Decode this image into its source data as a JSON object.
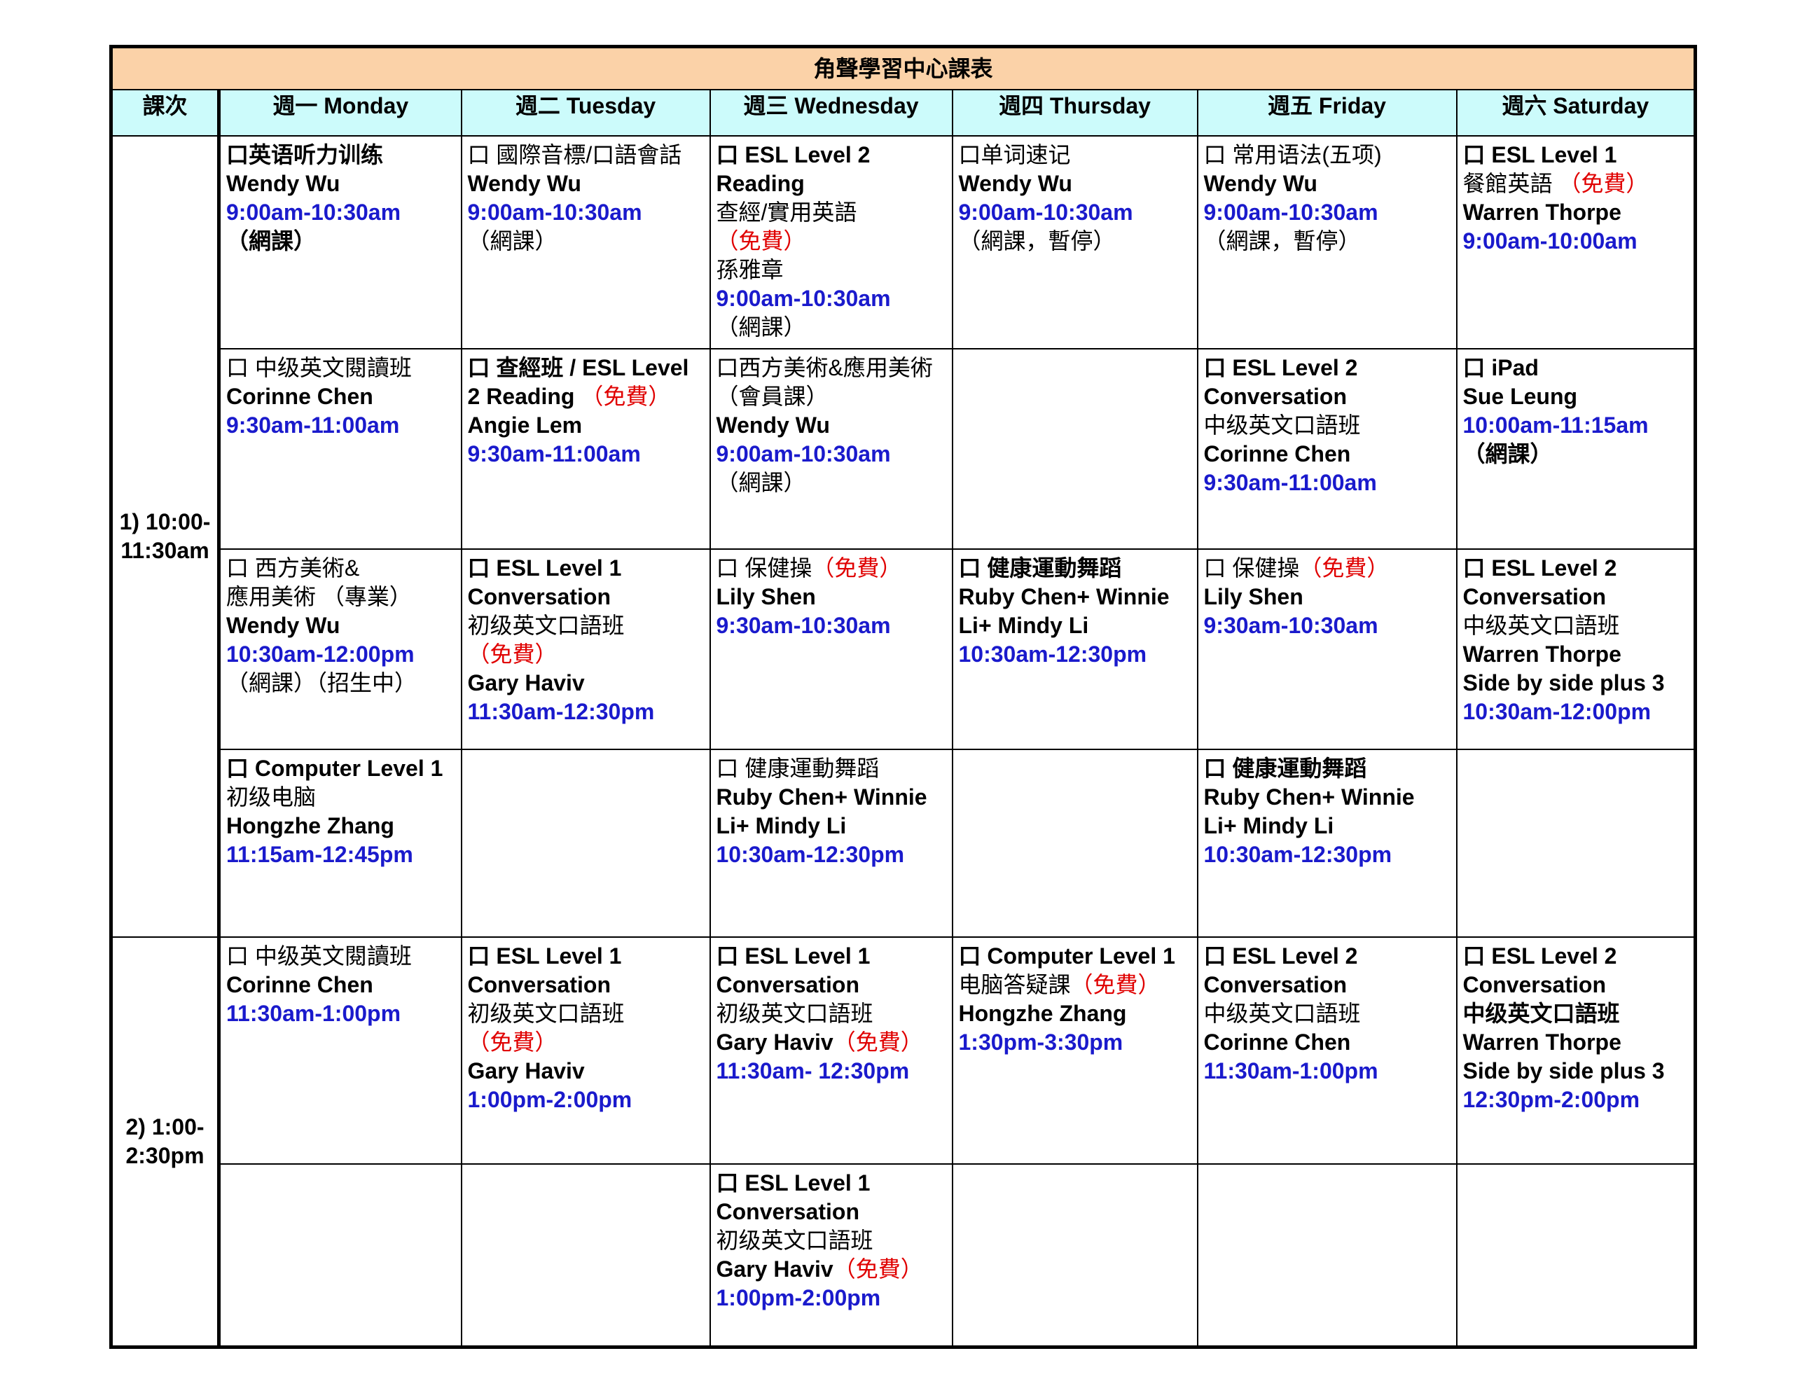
{
  "title": "角聲學習中心課表",
  "headers": {
    "period": "課次",
    "mon": "週一 Monday",
    "tue": "週二 Tuesday",
    "wed": "週三 Wednesday",
    "thu": "週四 Thursday",
    "fri": "週五 Friday",
    "sat": "週六 Saturday"
  },
  "periods": [
    "1) 10:00-11:30am",
    "2) 1:00-2:30pm"
  ],
  "cells": {
    "r1": {
      "mon": [
        {
          "text": "口英语听力训练",
          "style": "b"
        },
        {
          "text": "Wendy Wu",
          "style": "b"
        },
        {
          "text": "9:00am-10:30am",
          "style": "t"
        },
        {
          "text": "（網課）",
          "style": "b"
        }
      ],
      "tue": [
        {
          "text": "口 國際音標/口語會話",
          "style": ""
        },
        {
          "text": "Wendy Wu",
          "style": "b"
        },
        {
          "text": "9:00am-10:30am",
          "style": "t"
        },
        {
          "text": "（網課）",
          "style": ""
        }
      ],
      "wed": [
        {
          "text": "口 ESL Level 2",
          "style": "b"
        },
        {
          "text": "Reading",
          "style": "b"
        },
        {
          "text": "查經/實用英語",
          "style": ""
        },
        {
          "text": "（免費）",
          "style": "r"
        },
        {
          "text": " 孫雅章",
          "style": ""
        },
        {
          "text": "9:00am-10:30am",
          "style": "t"
        },
        {
          "text": "（網課）",
          "style": ""
        }
      ],
      "thu": [
        {
          "text": "口单词速记",
          "style": ""
        },
        {
          "text": "Wendy Wu",
          "style": "b"
        },
        {
          "text": "9:00am-10:30am",
          "style": "t"
        },
        {
          "text": "（網課，暫停）",
          "style": ""
        }
      ],
      "fri": [
        {
          "text": "口 常用语法(五项)",
          "style": ""
        },
        {
          "text": "Wendy Wu",
          "style": "b"
        },
        {
          "text": "9:00am-10:30am",
          "style": "t"
        },
        {
          "text": "（網課，暫停）",
          "style": ""
        }
      ],
      "sat": [
        {
          "text": "口 ESL Level 1",
          "style": "b"
        },
        {
          "text": " 餐館英語 ",
          "style": ""
        },
        {
          "text": "（免費）",
          "style": "r",
          "inline": true
        },
        {
          "text": "Warren Thorpe",
          "style": "b"
        },
        {
          "text": "9:00am-10:00am",
          "style": "t"
        }
      ]
    },
    "r2": {
      "mon": [
        {
          "text": "口 中级英文閱讀班",
          "style": ""
        },
        {
          "text": "Corinne Chen",
          "style": "b"
        },
        {
          "text": "9:30am-11:00am",
          "style": "t"
        }
      ],
      "tue": [
        {
          "text": "口 查經班 / ESL Level",
          "style": "b"
        },
        {
          "text": "2 Reading ",
          "style": "b"
        },
        {
          "text": "（免費）",
          "style": "r",
          "inline": true
        },
        {
          "text": "Angie Lem",
          "style": "b"
        },
        {
          "text": "9:30am-11:00am",
          "style": "t"
        }
      ],
      "wed": [
        {
          "text": "口西方美術&應用美術",
          "style": ""
        },
        {
          "text": "（會員課）",
          "style": ""
        },
        {
          "text": "Wendy Wu",
          "style": "b"
        },
        {
          "text": "9:00am-10:30am",
          "style": "t"
        },
        {
          "text": "（網課）",
          "style": ""
        }
      ],
      "thu": [],
      "fri": [
        {
          "text": "口 ESL Level 2",
          "style": "b"
        },
        {
          "text": "Conversation",
          "style": "b"
        },
        {
          "text": "中级英文口語班",
          "style": ""
        },
        {
          "text": "Corinne Chen",
          "style": "b"
        },
        {
          "text": "9:30am-11:00am",
          "style": "t"
        }
      ],
      "sat": [
        {
          "text": "口 iPad",
          "style": "b"
        },
        {
          "text": "Sue Leung",
          "style": "b"
        },
        {
          "text": "10:00am-11:15am",
          "style": "t"
        },
        {
          "text": " （網課）",
          "style": "b"
        }
      ]
    },
    "r3": {
      "mon": [
        {
          "text": "口 西方美術&",
          "style": ""
        },
        {
          "text": "應用美術 （專業）",
          "style": ""
        },
        {
          "text": "Wendy Wu",
          "style": "b"
        },
        {
          "text": "10:30am-12:00pm",
          "style": "t"
        },
        {
          "text": "（網課）（招生中）",
          "style": ""
        }
      ],
      "tue": [
        {
          "text": "口 ESL Level 1",
          "style": "b"
        },
        {
          "text": "Conversation",
          "style": "b"
        },
        {
          "text": "初级英文口語班",
          "style": ""
        },
        {
          "text": "（免費）",
          "style": "r"
        },
        {
          "text": "Gary Haviv",
          "style": "b"
        },
        {
          "text": "11:30am-12:30pm",
          "style": "t"
        }
      ],
      "wed": [
        {
          "text": "口 保健操",
          "style": ""
        },
        {
          "text": "（免費）",
          "style": "r",
          "inline": true
        },
        {
          "text": "Lily Shen",
          "style": "b"
        },
        {
          "text": "9:30am-10:30am",
          "style": "t"
        }
      ],
      "thu": [
        {
          "text": "口 健康運動舞蹈",
          "style": "b"
        },
        {
          "text": "Ruby Chen+ Winnie",
          "style": "b"
        },
        {
          "text": "Li+ Mindy Li",
          "style": "b"
        },
        {
          "text": "10:30am-12:30pm",
          "style": "t"
        }
      ],
      "fri": [
        {
          "text": "口 保健操",
          "style": ""
        },
        {
          "text": "（免費）",
          "style": "r",
          "inline": true
        },
        {
          "text": "Lily Shen",
          "style": "b"
        },
        {
          "text": "9:30am-10:30am",
          "style": "t"
        }
      ],
      "sat": [
        {
          "text": "口 ESL Level 2",
          "style": "b"
        },
        {
          "text": "Conversation",
          "style": "b"
        },
        {
          "text": "中级英文口語班",
          "style": ""
        },
        {
          "text": "Warren Thorpe",
          "style": "b"
        },
        {
          "text": "Side by side plus 3",
          "style": "b"
        },
        {
          "text": "10:30am-12:00pm",
          "style": "t"
        }
      ]
    },
    "r4": {
      "mon": [
        {
          "text": "口 Computer Level 1",
          "style": "b"
        },
        {
          "text": "初级电脑",
          "style": ""
        },
        {
          "text": "Hongzhe Zhang",
          "style": "b"
        },
        {
          "text": "11:15am-12:45pm",
          "style": "t"
        }
      ],
      "tue": [],
      "wed": [
        {
          "text": "口 健康運動舞蹈",
          "style": ""
        },
        {
          "text": "Ruby Chen+ Winnie",
          "style": "b"
        },
        {
          "text": "Li+ Mindy Li",
          "style": "b"
        },
        {
          "text": "10:30am-12:30pm",
          "style": "t"
        }
      ],
      "thu": [],
      "fri": [
        {
          "text": "口 健康運動舞蹈",
          "style": "b"
        },
        {
          "text": "Ruby Chen+ Winnie",
          "style": "b"
        },
        {
          "text": "Li+ Mindy Li",
          "style": "b"
        },
        {
          "text": "10:30am-12:30pm",
          "style": "t"
        }
      ],
      "sat": []
    },
    "r5": {
      "mon": [
        {
          "text": "口 中级英文閱讀班",
          "style": ""
        },
        {
          "text": "Corinne Chen",
          "style": "b"
        },
        {
          "text": "11:30am-1:00pm",
          "style": "t"
        }
      ],
      "tue": [
        {
          "text": "口 ESL Level 1",
          "style": "b"
        },
        {
          "text": "Conversation",
          "style": "b"
        },
        {
          "text": "初级英文口語班",
          "style": ""
        },
        {
          "text": "（免費）",
          "style": "r"
        },
        {
          "text": "Gary Haviv",
          "style": "b"
        },
        {
          "text": "1:00pm-2:00pm",
          "style": "t"
        }
      ],
      "wed": [
        {
          "text": "口 ESL Level 1",
          "style": "b"
        },
        {
          "text": "Conversation",
          "style": "b"
        },
        {
          "text": "初级英文口語班",
          "style": ""
        },
        {
          "text": " Gary Haviv",
          "style": "b"
        },
        {
          "text": "（免費）",
          "style": "r",
          "inline": true
        },
        {
          "text": "11:30am- 12:30pm",
          "style": "t"
        }
      ],
      "thu": [
        {
          "text": "口 Computer Level 1",
          "style": "b"
        },
        {
          "text": "电脑答疑課",
          "style": ""
        },
        {
          "text": "（免費）",
          "style": "r",
          "inline": true
        },
        {
          "text": "Hongzhe Zhang",
          "style": "b"
        },
        {
          "text": "1:30pm-3:30pm",
          "style": "t"
        }
      ],
      "fri": [
        {
          "text": "口 ESL Level 2",
          "style": "b"
        },
        {
          "text": "Conversation",
          "style": "b"
        },
        {
          "text": "中级英文口語班",
          "style": ""
        },
        {
          "text": "Corinne Chen",
          "style": "b"
        },
        {
          "text": "11:30am-1:00pm",
          "style": "t"
        }
      ],
      "sat": [
        {
          "text": "口 ESL Level 2",
          "style": "b"
        },
        {
          "text": "Conversation",
          "style": "b"
        },
        {
          "text": "中级英文口語班",
          "style": "b"
        },
        {
          "text": "Warren Thorpe",
          "style": "b"
        },
        {
          "text": "Side by side plus 3",
          "style": "b"
        },
        {
          "text": "12:30pm-2:00pm",
          "style": "t"
        }
      ]
    },
    "r6": {
      "mon": [],
      "tue": [],
      "wed": [
        {
          "text": "口 ESL Level 1",
          "style": "b"
        },
        {
          "text": "Conversation",
          "style": "b"
        },
        {
          "text": "初级英文口語班",
          "style": ""
        },
        {
          "text": " Gary Haviv",
          "style": "b"
        },
        {
          "text": "（免費）",
          "style": "r",
          "inline": true
        },
        {
          "text": "1:00pm-2:00pm",
          "style": "t"
        }
      ],
      "thu": [],
      "fri": [],
      "sat": []
    }
  }
}
